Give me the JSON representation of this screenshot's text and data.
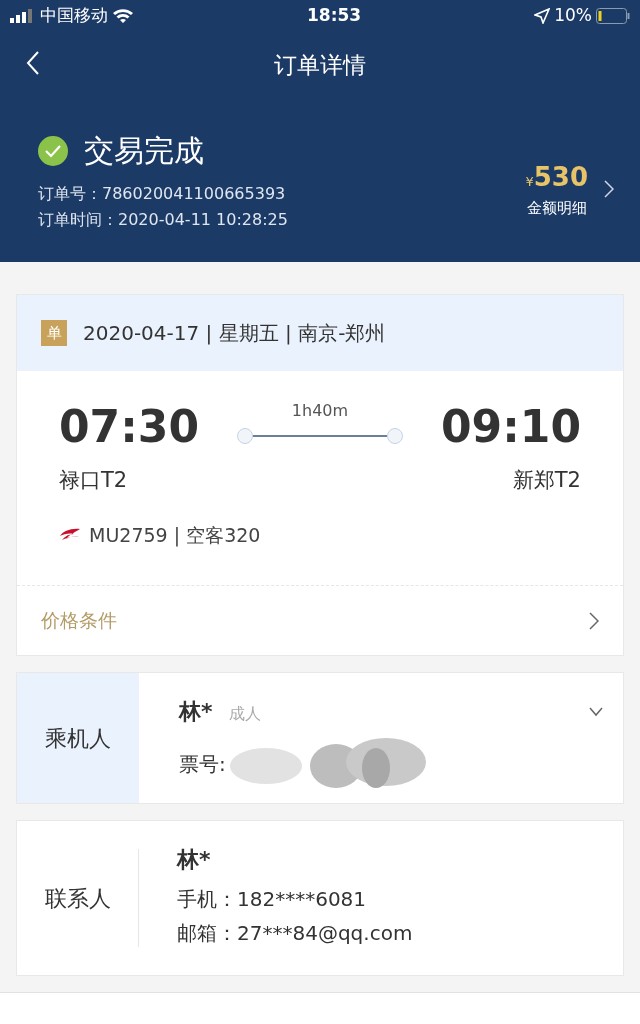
{
  "status_bar": {
    "carrier": "中国移动",
    "time": "18:53",
    "battery": "10%"
  },
  "nav": {
    "title": "订单详情"
  },
  "order": {
    "status": "交易完成",
    "number_label": "订单号：",
    "number": "786020041100665393",
    "time_label": "订单时间：",
    "time": "2020-04-11 10:28:25",
    "currency": "¥",
    "amount": "530",
    "amount_label": "金额明细"
  },
  "flight": {
    "badge": "单",
    "summary": "2020-04-17 | 星期五 | 南京-郑州",
    "depart_time": "07:30",
    "depart_airport": "禄口T2",
    "duration": "1h40m",
    "arrive_time": "09:10",
    "arrive_airport": "新郑T2",
    "flight_info": "MU2759 | 空客320",
    "price_terms": "价格条件"
  },
  "passenger": {
    "section": "乘机人",
    "name": "林*",
    "type": "成人",
    "ticket_label": "票号:",
    "expanded": false
  },
  "contact": {
    "section": "联系人",
    "name": "林*",
    "phone_label": "手机：",
    "phone": "182****6081",
    "email_label": "邮箱：",
    "email": "27***84@qq.com"
  }
}
